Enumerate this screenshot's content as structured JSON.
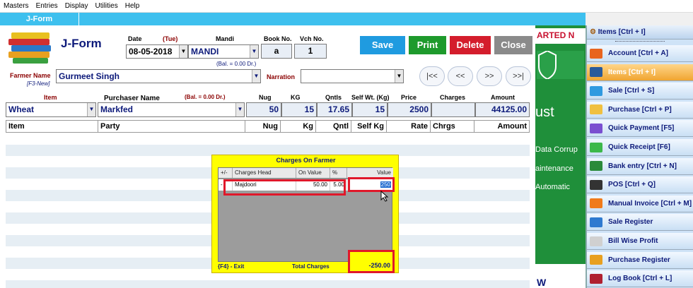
{
  "menu": [
    "Masters",
    "Entries",
    "Display",
    "Utilities",
    "Help"
  ],
  "tab": "J-Form",
  "form": {
    "title": "J-Form",
    "date_label": "Date",
    "day": "(Tue)",
    "date_value": "08-05-2018",
    "mandi_label": "Mandi",
    "mandi_value": "MANDI",
    "mandi_balance": "(Bal. = 0.00 Dr.)",
    "bookno_label": "Book No.",
    "bookno_value": "a",
    "vchno_label": "Vch No.",
    "vchno_value": "1",
    "farmer_label": "Farmer Name",
    "farmer_hint": "[F3-New]",
    "farmer_value": "Gurmeet Singh",
    "narration_label": "Narration",
    "narration_value": "",
    "item_label": "Item",
    "purchaser_label": "Purchaser Name",
    "purchaser_balance": "(Bal. = 0.00 Dr.)",
    "nug_label": "Nug",
    "kg_label": "KG",
    "qntls_label": "Qntls",
    "selfwt_label": "Self Wt. (Kg)",
    "price_label": "Price",
    "charges_label": "Charges",
    "amount_label": "Amount",
    "item_value": "Wheat",
    "purchaser_value": "Markfed",
    "nug_value": "50",
    "kg_value": "15",
    "qntls_value": "17.65",
    "selfwt_value": "15",
    "price_value": "2500",
    "charges_value": "",
    "amount_value": "44125.00"
  },
  "buttons": {
    "save": "Save",
    "print": "Print",
    "delete": "Delete",
    "close": "Close",
    "first": "|<<",
    "prev": "<<",
    "next": ">>",
    "last": ">>|"
  },
  "grid": {
    "columns": [
      "Item",
      "Party",
      "Nug",
      "Kg",
      "Qntl",
      "Self Kg",
      "Rate",
      "Chrgs",
      "Amount"
    ]
  },
  "dialog": {
    "title": "Charges On Farmer",
    "columns": [
      "+/-",
      "Charges Head",
      "On Value",
      "%",
      "Value"
    ],
    "row": {
      "sign": "-",
      "head": "Majdoori",
      "on_value": "50.00",
      "percent": "5.00",
      "value": "250"
    },
    "exit_hint": "{F4} - Exit",
    "total_label": "Total Charges",
    "total_value": "-250.00"
  },
  "sidebar": {
    "header": "Items [Ctrl + I]",
    "items": [
      {
        "label": "Account [Ctrl + A]",
        "icon": "account-icon",
        "color": "#e8641e"
      },
      {
        "label": "Items [Ctrl + I]",
        "icon": "items-icon",
        "color": "#2a5a9a"
      },
      {
        "label": "Sale [Ctrl + S]",
        "icon": "sale-icon",
        "color": "#2f9ae0"
      },
      {
        "label": "Purchase [Ctrl + P]",
        "icon": "purchase-icon",
        "color": "#f0c040"
      },
      {
        "label": "Quick Payment [F5]",
        "icon": "quick-payment-icon",
        "color": "#7a4fd0"
      },
      {
        "label": "Quick Receipt [F6]",
        "icon": "quick-receipt-icon",
        "color": "#3cb84a"
      },
      {
        "label": "Bank entry [Ctrl + N]",
        "icon": "bank-entry-icon",
        "color": "#2a8a3a"
      },
      {
        "label": "POS [Ctrl + Q]",
        "icon": "pos-icon",
        "color": "#333333"
      },
      {
        "label": "Manual Invoice [Ctrl + M]",
        "icon": "manual-invoice-icon",
        "color": "#f07a1a"
      },
      {
        "label": "Sale Register",
        "icon": "sale-register-icon",
        "color": "#2f7ad0"
      },
      {
        "label": "Bill Wise Profit",
        "icon": "bill-wise-profit-icon",
        "color": "#d0d0d0"
      },
      {
        "label": "Purchase Register",
        "icon": "purchase-register-icon",
        "color": "#e8a020"
      },
      {
        "label": "Log Book [Ctrl + L]",
        "icon": "log-book-icon",
        "color": "#b02030"
      }
    ]
  },
  "background": {
    "banner": "ARTED N",
    "lines": [
      "ust",
      "Data Corrup",
      "aintenance",
      "Automatic",
      "W"
    ]
  }
}
